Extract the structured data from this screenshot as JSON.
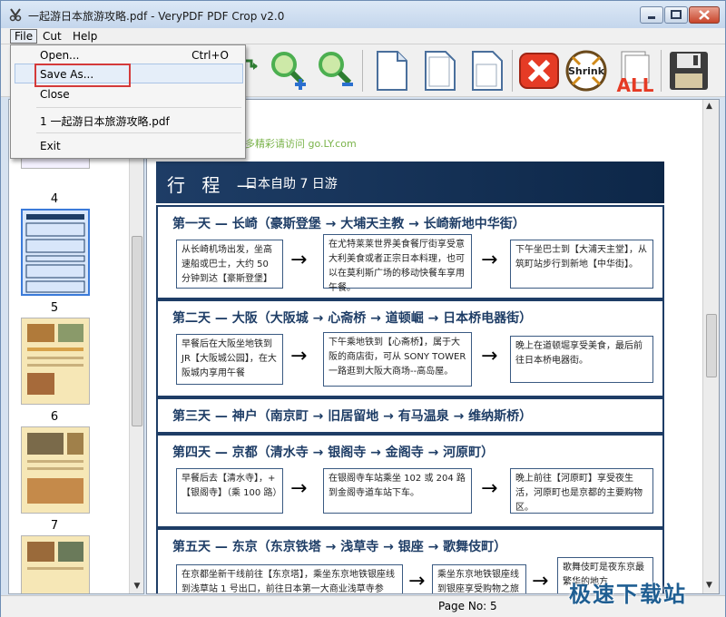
{
  "window": {
    "title": "一起游日本旅游攻略.pdf - VeryPDF PDF Crop v2.0"
  },
  "menubar": {
    "items": [
      "File",
      "Cut",
      "Help"
    ]
  },
  "file_menu": {
    "open": "Open...",
    "open_shortcut": "Ctrl+O",
    "save_as": "Save As...",
    "close": "Close",
    "recent": "1 一起游日本旅游攻略.pdf",
    "exit": "Exit"
  },
  "thumbnails": [
    {
      "number": "4",
      "selected": true
    },
    {
      "number": "5",
      "selected": false
    },
    {
      "number": "6",
      "selected": false
    },
    {
      "number": "7",
      "selected": false
    }
  ],
  "doc": {
    "link": "多精彩请访问 go.LY.com",
    "banner_title": "行 程 —",
    "banner_sub": "日本自助 7 日游",
    "days": [
      {
        "title": "第一天 — 长崎（豪斯登堡 → 大埔天主教 → 长崎新地中华街）",
        "boxes": [
          "从长崎机场出发，坐高速船或巴士，大约 50 分钟到达【豪斯登堡】",
          "在尤特莱莱世界美食餐厅街享受意大利美食或者正宗日本料理，也可以在莫利斯广场的移动快餐车享用午餐。",
          "下午坐巴士到【大浦天主堂】，从筑町站步行到新地【中华街】。"
        ]
      },
      {
        "title": "第二天 — 大阪（大阪城 → 心斋桥 → 道顿崛 → 日本桥电器街）",
        "boxes": [
          "早餐后在大阪坐地铁到JR【大阪城公园】，在大阪城内享用午餐",
          "下午乘地铁到【心斋桥】，属于大阪的商店街，可从 SONY TOWER 一路逛到大阪大商场--高岛屋。",
          "晚上在道顿堀享受美食，最后前往日本桥电器街。"
        ]
      },
      {
        "title": "第三天 — 神户（南京町 → 旧居留地 → 有马温泉 → 维纳斯桥）",
        "boxes": []
      },
      {
        "title": "第四天 — 京都（清水寺 → 银阁寺 → 金阁寺 → 河原町）",
        "boxes": [
          "早餐后去【清水寺】，+【银阁寺】（乘 100 路）",
          "在银阁寺车站乘坐 102 或 204 路到金阁寺道车站下车。",
          "晚上前往【河原町】享受夜生活，河原町也是京都的主要购物区。"
        ]
      },
      {
        "title": "第五天 — 东京（东京铁塔 → 浅草寺 → 银座 → 歌舞伎町）",
        "boxes": [
          "在京都坐新干线前往【东京塔】，乘坐东京地铁银座线到浅草站 1 号出口，前往日本第一大商业浅草寺参观。",
          "乘坐东京地铁银座线到银座享受购物之旅",
          "歌舞伎町是夜东京最繁华的地方"
        ]
      }
    ]
  },
  "status": {
    "page": "Page No: 5"
  },
  "overlay_watermark": "极速下载站",
  "colors": {
    "accent": "#1e3d66",
    "highlight_red": "#d43a3a",
    "link_green": "#7ab34a"
  },
  "toolbar_icons": [
    "open-folder-icon",
    "zoom-in-icon",
    "zoom-out-icon",
    "page-blank-icon",
    "page-single-icon",
    "page-double-icon",
    "cancel-icon",
    "shrink-icon",
    "all-pages-icon",
    "save-floppy-icon"
  ],
  "toolbar_labels": {
    "shrink": "Shrink",
    "all": "ALL"
  }
}
